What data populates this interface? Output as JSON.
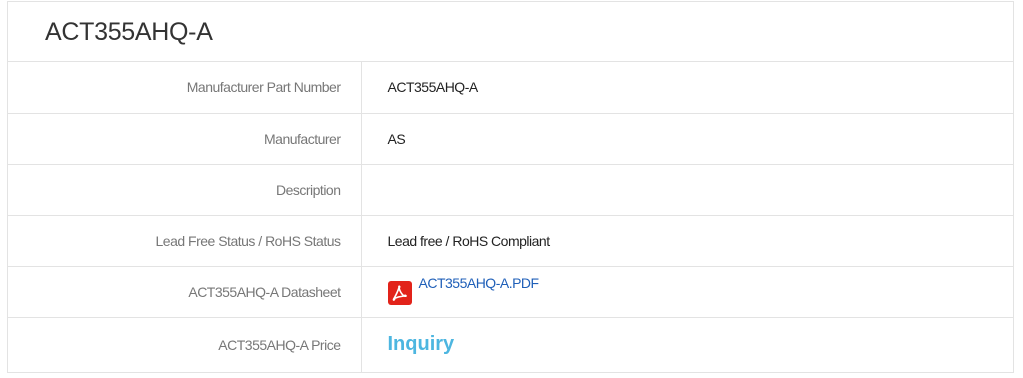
{
  "product": {
    "title": "ACT355AHQ-A"
  },
  "specs": {
    "part_number_label": "Manufacturer Part Number",
    "part_number_value": "ACT355AHQ-A",
    "manufacturer_label": "Manufacturer",
    "manufacturer_value": "AS",
    "description_label": "Description",
    "description_value": "",
    "rohs_label": "Lead Free Status / RoHS Status",
    "rohs_value": "Lead free / RoHS Compliant",
    "datasheet_label": "ACT355AHQ-A Datasheet",
    "datasheet_link": "ACT355AHQ-A.PDF",
    "datasheet_icon": "pdf-icon",
    "price_label": "ACT355AHQ-A Price",
    "price_link": "Inquiry"
  },
  "colors": {
    "pdf_icon": "#e2231a",
    "datasheet_link": "#1f5fb8",
    "inquiry_link": "#4db6e0"
  }
}
